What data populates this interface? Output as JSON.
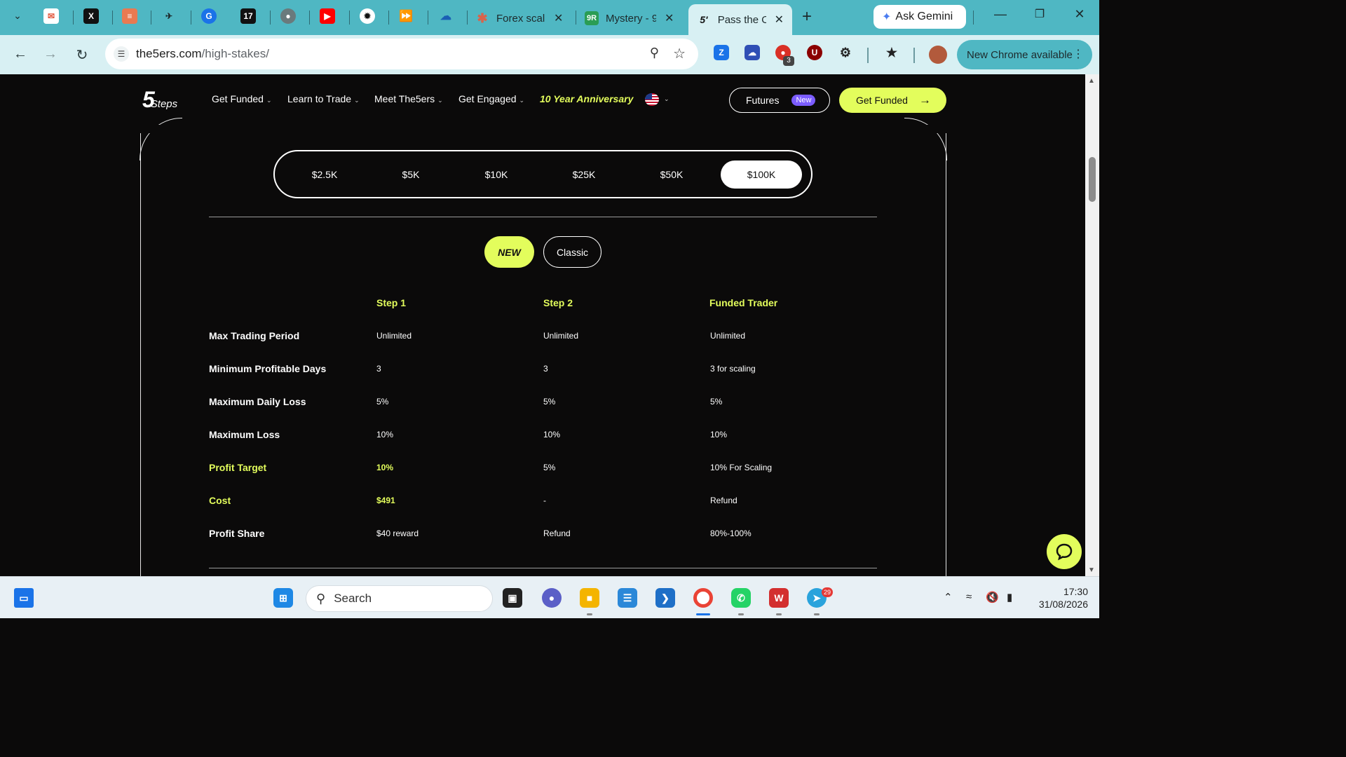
{
  "browser": {
    "tabs": [
      {
        "title": "Forex scalp",
        "favicon": "asterisk-icon"
      },
      {
        "title": "Mystery - 9",
        "favicon": "9r-icon"
      },
      {
        "title": "Pass the O",
        "favicon": "5ers-icon",
        "active": true
      }
    ],
    "ask_gemini": "Ask Gemini",
    "url_host": "the5ers.com",
    "url_path": "/high-stakes/",
    "ext_badge": "3",
    "update_label": "New Chrome available"
  },
  "site": {
    "logo_number": "5",
    "logo_word": "Steps",
    "nav": [
      "Get Funded",
      "Learn to Trade",
      "Meet The5ers",
      "Get Engaged"
    ],
    "anniversary": "10 Year Anniversary",
    "futures_label": "Futures",
    "futures_badge": "New",
    "cta_label": "Get Funded",
    "accent": "#e3fd5c"
  },
  "account_sizes": [
    "$2.5K",
    "$5K",
    "$10K",
    "$25K",
    "$50K",
    "$100K"
  ],
  "selected_size": "$100K",
  "models": {
    "new": "NEW",
    "classic": "Classic",
    "selected": "NEW"
  },
  "table": {
    "columns": [
      "Step 1",
      "Step 2",
      "Funded Trader"
    ],
    "rows": [
      {
        "label": "Max Trading Period",
        "cells": [
          "Unlimited",
          "Unlimited",
          "Unlimited"
        ]
      },
      {
        "label": "Minimum Profitable Days",
        "cells": [
          "3",
          "3",
          "3 for scaling"
        ]
      },
      {
        "label": "Maximum Daily Loss",
        "cells": [
          "5%",
          "5%",
          "5%"
        ]
      },
      {
        "label": "Maximum Loss",
        "cells": [
          "10%",
          "10%",
          "10%"
        ]
      },
      {
        "label": "Profit Target",
        "cells": [
          "10%",
          "5%",
          "10% For Scaling"
        ],
        "highlight": true
      },
      {
        "label": "Cost",
        "cells": [
          "$491",
          "-",
          "Refund"
        ],
        "highlight": true
      },
      {
        "label": "Profit Share",
        "cells": [
          "$40 reward",
          "Refund",
          "80%-100%"
        ]
      }
    ]
  },
  "taskbar": {
    "search_placeholder": "Search",
    "telegram_badge": "29",
    "time": "17:30",
    "date": "31/08/2026"
  }
}
